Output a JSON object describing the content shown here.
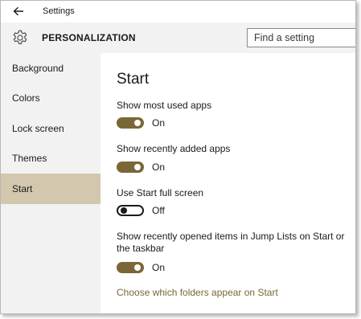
{
  "window": {
    "title": "Settings"
  },
  "header": {
    "title": "PERSONALIZATION",
    "search_placeholder": "Find a setting"
  },
  "sidebar": {
    "items": [
      {
        "label": "Background",
        "selected": false
      },
      {
        "label": "Colors",
        "selected": false
      },
      {
        "label": "Lock screen",
        "selected": false
      },
      {
        "label": "Themes",
        "selected": false
      },
      {
        "label": "Start",
        "selected": true
      }
    ]
  },
  "content": {
    "title": "Start",
    "settings": [
      {
        "label": "Show most used apps",
        "state": "On",
        "on": true
      },
      {
        "label": "Show recently added apps",
        "state": "On",
        "on": true
      },
      {
        "label": "Use Start full screen",
        "state": "Off",
        "on": false
      },
      {
        "label": "Show recently opened items in Jump Lists on Start or the taskbar",
        "state": "On",
        "on": true
      }
    ],
    "link": "Choose which folders appear on Start"
  },
  "colors": {
    "accent": "#7a6637",
    "selected_nav": "#d3c7ad",
    "panel_background": "#f2f2f2"
  },
  "icons": {
    "back": "back-arrow-icon",
    "settings": "gear-icon"
  }
}
